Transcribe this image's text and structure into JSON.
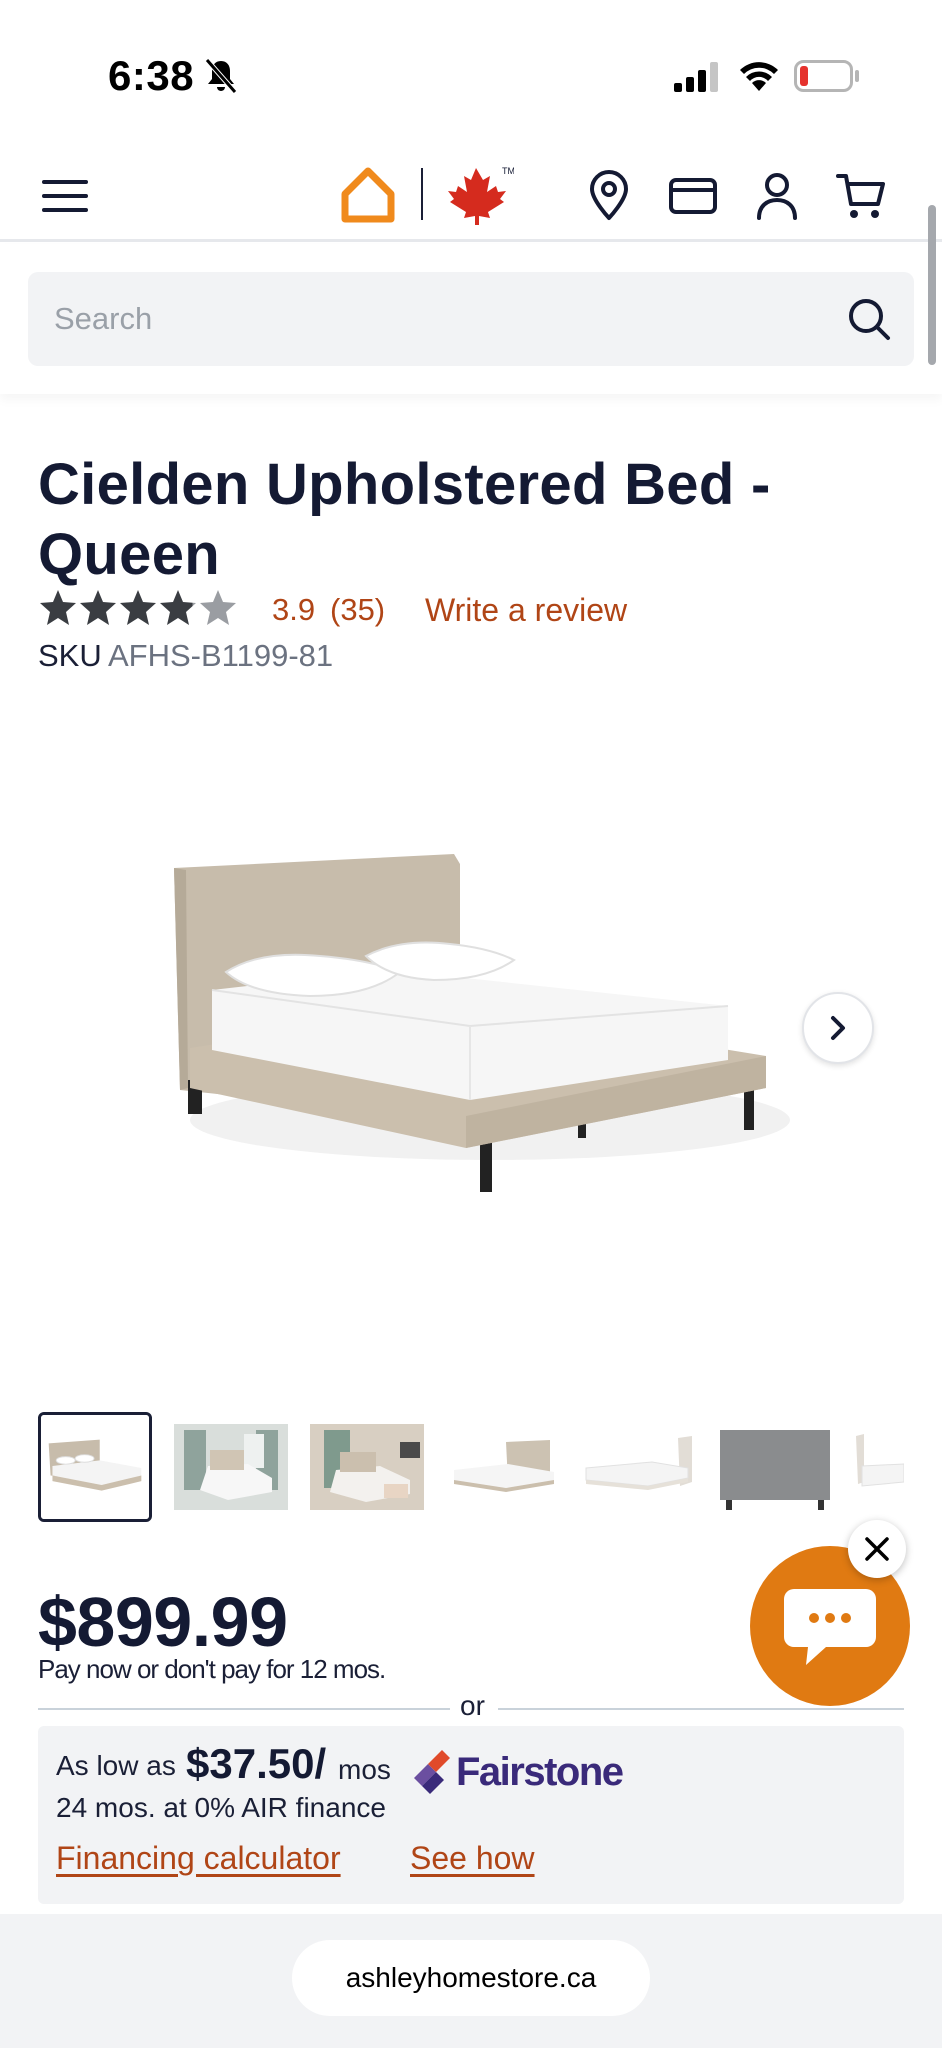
{
  "status_bar": {
    "time": "6:38"
  },
  "header": {
    "icons": [
      "menu-icon",
      "home-logo-icon",
      "maple-leaf-icon",
      "location-pin-icon",
      "credit-card-icon",
      "account-icon",
      "cart-icon"
    ],
    "brand_color": "#f08a1c"
  },
  "search": {
    "placeholder": "Search"
  },
  "product": {
    "title": "Cielden Upholstered Bed - Queen",
    "rating": {
      "value": "3.9",
      "count": "(35)",
      "stars_filled": 3.9,
      "stars_total": 5,
      "write_review": "Write a review"
    },
    "sku_label": "SKU",
    "sku_value": "AFHS-B1199-81",
    "thumbnails_count": 7,
    "active_thumbnail": 1
  },
  "pricing": {
    "price": "$899.99",
    "pay_later": "Pay now or don't pay for 12 mos.",
    "or": "or"
  },
  "financing": {
    "as_low_as": "As low as",
    "monthly_amount": "$37.50/",
    "mos": "mos",
    "terms": "24 mos. at 0% AIR finance",
    "provider": "Fairstone",
    "calculator_link": "Financing calculator",
    "see_how_link": "See how"
  },
  "browser": {
    "url": "ashleyhomestore.ca"
  },
  "colors": {
    "link": "#b04516",
    "title": "#141a33",
    "chat": "#e07a12",
    "fairstone": "#3a2a7a"
  }
}
